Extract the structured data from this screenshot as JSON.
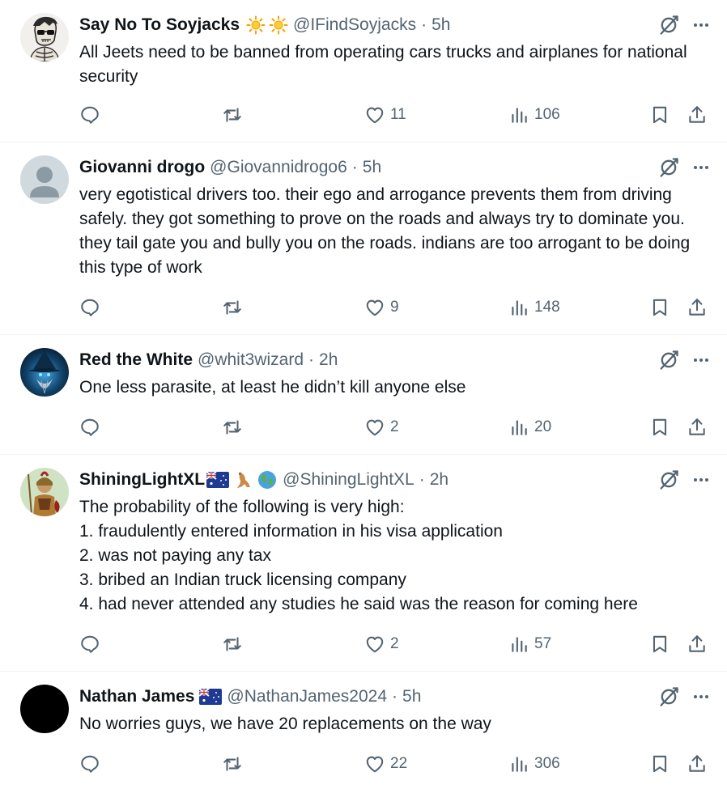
{
  "tweets": [
    {
      "name": "Say No To Soyjacks",
      "emojis": [
        "sun",
        "sun"
      ],
      "handle": "@IFindSoyjacks",
      "dot": "·",
      "time": "5h",
      "text": "All Jeets need to be banned from operating cars trucks and airplanes for national security",
      "replies": "",
      "retweets": "",
      "likes": "11",
      "views": "106",
      "avatar": "skeleton-sunglasses"
    },
    {
      "name": "Giovanni drogo",
      "emojis": [],
      "handle": "@Giovannidrogo6",
      "dot": "·",
      "time": "5h",
      "text": "very egotistical drivers too. their ego and arrogance prevents them from driving safely. they got something to prove on the roads and always try to dominate you. they tail gate you and bully you on the roads. indians are too arrogant to be doing this type of work",
      "replies": "",
      "retweets": "",
      "likes": "9",
      "views": "148",
      "avatar": "default-profile"
    },
    {
      "name": "Red the White",
      "emojis": [],
      "handle": "@whit3wizard",
      "dot": "·",
      "time": "2h",
      "text": "One less parasite, at least he didn’t kill anyone else",
      "replies": "",
      "retweets": "",
      "likes": "2",
      "views": "20",
      "avatar": "blue-wizard"
    },
    {
      "name": "ShiningLightXL",
      "emojis": [
        "australia-flag",
        "kangaroo",
        "globe"
      ],
      "handle": "@ShiningLightXL",
      "dot": "·",
      "time": "2h",
      "text": "The probability of the following is very high:\n1. fraudulently entered information in his visa application\n2. was not paying any tax\n3. bribed an Indian truck licensing company\n4. had never attended any studies he said was the reason for coming here",
      "replies": "",
      "retweets": "",
      "likes": "2",
      "views": "57",
      "avatar": "spartan-warrior"
    },
    {
      "name": "Nathan James",
      "emojis": [
        "australia-flag"
      ],
      "handle": "@NathanJames2024",
      "dot": "·",
      "time": "5h",
      "text": "No worries guys, we have 20 replacements on the way",
      "replies": "",
      "retweets": "",
      "likes": "22",
      "views": "306",
      "avatar": "black-circle"
    }
  ],
  "colors": {
    "text_primary": "#0f1419",
    "text_secondary": "#536471",
    "divider": "#eff3f4",
    "background": "#ffffff"
  }
}
